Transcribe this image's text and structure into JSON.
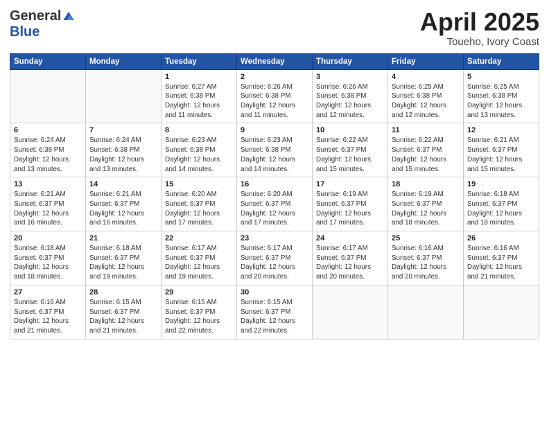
{
  "logo": {
    "general": "General",
    "blue": "Blue"
  },
  "title": {
    "month": "April 2025",
    "location": "Toueho, Ivory Coast"
  },
  "weekdays": [
    "Sunday",
    "Monday",
    "Tuesday",
    "Wednesday",
    "Thursday",
    "Friday",
    "Saturday"
  ],
  "weeks": [
    [
      {
        "day": "",
        "info": ""
      },
      {
        "day": "",
        "info": ""
      },
      {
        "day": "1",
        "info": "Sunrise: 6:27 AM\nSunset: 6:38 PM\nDaylight: 12 hours and 11 minutes."
      },
      {
        "day": "2",
        "info": "Sunrise: 6:26 AM\nSunset: 6:38 PM\nDaylight: 12 hours and 11 minutes."
      },
      {
        "day": "3",
        "info": "Sunrise: 6:26 AM\nSunset: 6:38 PM\nDaylight: 12 hours and 12 minutes."
      },
      {
        "day": "4",
        "info": "Sunrise: 6:25 AM\nSunset: 6:38 PM\nDaylight: 12 hours and 12 minutes."
      },
      {
        "day": "5",
        "info": "Sunrise: 6:25 AM\nSunset: 6:38 PM\nDaylight: 12 hours and 13 minutes."
      }
    ],
    [
      {
        "day": "6",
        "info": "Sunrise: 6:24 AM\nSunset: 6:38 PM\nDaylight: 12 hours and 13 minutes."
      },
      {
        "day": "7",
        "info": "Sunrise: 6:24 AM\nSunset: 6:38 PM\nDaylight: 12 hours and 13 minutes."
      },
      {
        "day": "8",
        "info": "Sunrise: 6:23 AM\nSunset: 6:38 PM\nDaylight: 12 hours and 14 minutes."
      },
      {
        "day": "9",
        "info": "Sunrise: 6:23 AM\nSunset: 6:38 PM\nDaylight: 12 hours and 14 minutes."
      },
      {
        "day": "10",
        "info": "Sunrise: 6:22 AM\nSunset: 6:37 PM\nDaylight: 12 hours and 15 minutes."
      },
      {
        "day": "11",
        "info": "Sunrise: 6:22 AM\nSunset: 6:37 PM\nDaylight: 12 hours and 15 minutes."
      },
      {
        "day": "12",
        "info": "Sunrise: 6:21 AM\nSunset: 6:37 PM\nDaylight: 12 hours and 15 minutes."
      }
    ],
    [
      {
        "day": "13",
        "info": "Sunrise: 6:21 AM\nSunset: 6:37 PM\nDaylight: 12 hours and 16 minutes."
      },
      {
        "day": "14",
        "info": "Sunrise: 6:21 AM\nSunset: 6:37 PM\nDaylight: 12 hours and 16 minutes."
      },
      {
        "day": "15",
        "info": "Sunrise: 6:20 AM\nSunset: 6:37 PM\nDaylight: 12 hours and 17 minutes."
      },
      {
        "day": "16",
        "info": "Sunrise: 6:20 AM\nSunset: 6:37 PM\nDaylight: 12 hours and 17 minutes."
      },
      {
        "day": "17",
        "info": "Sunrise: 6:19 AM\nSunset: 6:37 PM\nDaylight: 12 hours and 17 minutes."
      },
      {
        "day": "18",
        "info": "Sunrise: 6:19 AM\nSunset: 6:37 PM\nDaylight: 12 hours and 18 minutes."
      },
      {
        "day": "19",
        "info": "Sunrise: 6:18 AM\nSunset: 6:37 PM\nDaylight: 12 hours and 18 minutes."
      }
    ],
    [
      {
        "day": "20",
        "info": "Sunrise: 6:18 AM\nSunset: 6:37 PM\nDaylight: 12 hours and 18 minutes."
      },
      {
        "day": "21",
        "info": "Sunrise: 6:18 AM\nSunset: 6:37 PM\nDaylight: 12 hours and 19 minutes."
      },
      {
        "day": "22",
        "info": "Sunrise: 6:17 AM\nSunset: 6:37 PM\nDaylight: 12 hours and 19 minutes."
      },
      {
        "day": "23",
        "info": "Sunrise: 6:17 AM\nSunset: 6:37 PM\nDaylight: 12 hours and 20 minutes."
      },
      {
        "day": "24",
        "info": "Sunrise: 6:17 AM\nSunset: 6:37 PM\nDaylight: 12 hours and 20 minutes."
      },
      {
        "day": "25",
        "info": "Sunrise: 6:16 AM\nSunset: 6:37 PM\nDaylight: 12 hours and 20 minutes."
      },
      {
        "day": "26",
        "info": "Sunrise: 6:16 AM\nSunset: 6:37 PM\nDaylight: 12 hours and 21 minutes."
      }
    ],
    [
      {
        "day": "27",
        "info": "Sunrise: 6:16 AM\nSunset: 6:37 PM\nDaylight: 12 hours and 21 minutes."
      },
      {
        "day": "28",
        "info": "Sunrise: 6:15 AM\nSunset: 6:37 PM\nDaylight: 12 hours and 21 minutes."
      },
      {
        "day": "29",
        "info": "Sunrise: 6:15 AM\nSunset: 6:37 PM\nDaylight: 12 hours and 22 minutes."
      },
      {
        "day": "30",
        "info": "Sunrise: 6:15 AM\nSunset: 6:37 PM\nDaylight: 12 hours and 22 minutes."
      },
      {
        "day": "",
        "info": ""
      },
      {
        "day": "",
        "info": ""
      },
      {
        "day": "",
        "info": ""
      }
    ]
  ]
}
